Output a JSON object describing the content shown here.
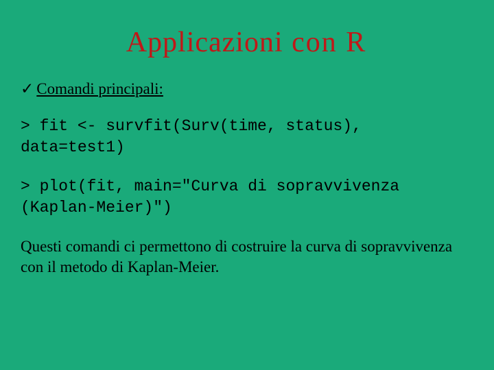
{
  "title": {
    "word1": "Applicazioni",
    "word2": "con",
    "word3": "R"
  },
  "heading": "Comandi principali:",
  "code1": "> fit <- survfit(Surv(time, status), data=test1)",
  "code2": "> plot(fit, main=\"Curva di sopravvivenza (Kaplan-Meier)\")",
  "description": "Questi comandi ci permettono di costruire la curva di sopravvivenza con il metodo di Kaplan-Meier."
}
